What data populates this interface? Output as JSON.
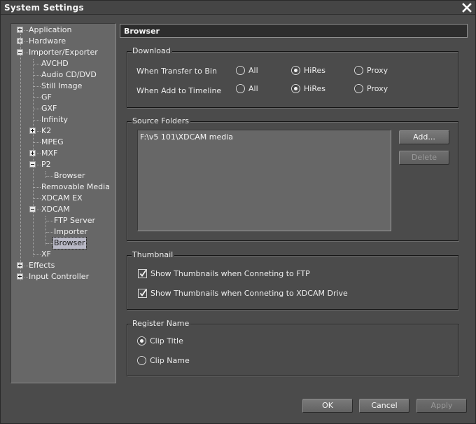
{
  "window": {
    "title": "System Settings",
    "close_icon": "close-icon"
  },
  "tree": {
    "items": [
      {
        "label": "Application",
        "level": 0,
        "toggle": "plus"
      },
      {
        "label": "Hardware",
        "level": 0,
        "toggle": "plus"
      },
      {
        "label": "Importer/Exporter",
        "level": 0,
        "toggle": "minus"
      },
      {
        "label": "AVCHD",
        "level": 1,
        "toggle": null
      },
      {
        "label": "Audio CD/DVD",
        "level": 1,
        "toggle": null
      },
      {
        "label": "Still Image",
        "level": 1,
        "toggle": null
      },
      {
        "label": "GF",
        "level": 1,
        "toggle": null
      },
      {
        "label": "GXF",
        "level": 1,
        "toggle": null
      },
      {
        "label": "Infinity",
        "level": 1,
        "toggle": null
      },
      {
        "label": "K2",
        "level": 1,
        "toggle": "plus"
      },
      {
        "label": "MPEG",
        "level": 1,
        "toggle": null
      },
      {
        "label": "MXF",
        "level": 1,
        "toggle": "plus"
      },
      {
        "label": "P2",
        "level": 1,
        "toggle": "minus"
      },
      {
        "label": "Browser",
        "level": 2,
        "toggle": null
      },
      {
        "label": "Removable Media",
        "level": 1,
        "toggle": null
      },
      {
        "label": "XDCAM EX",
        "level": 1,
        "toggle": null
      },
      {
        "label": "XDCAM",
        "level": 1,
        "toggle": "minus"
      },
      {
        "label": "FTP Server",
        "level": 2,
        "toggle": null
      },
      {
        "label": "Importer",
        "level": 2,
        "toggle": null
      },
      {
        "label": "Browser",
        "level": 2,
        "toggle": null,
        "selected": true
      },
      {
        "label": "XF",
        "level": 1,
        "toggle": null
      },
      {
        "label": "Effects",
        "level": 0,
        "toggle": "plus"
      },
      {
        "label": "Input Controller",
        "level": 0,
        "toggle": "plus"
      }
    ]
  },
  "panel": {
    "title": "Browser",
    "download": {
      "title": "Download",
      "rows": [
        {
          "label": "When Transfer to Bin",
          "options": [
            "All",
            "HiRes",
            "Proxy"
          ],
          "selected": "HiRes"
        },
        {
          "label": "When Add to Timeline",
          "options": [
            "All",
            "HiRes",
            "Proxy"
          ],
          "selected": "HiRes"
        }
      ]
    },
    "source_folders": {
      "title": "Source Folders",
      "items": [
        "F:\\v5 101\\XDCAM media"
      ],
      "add_label": "Add...",
      "delete_label": "Delete"
    },
    "thumbnail": {
      "title": "Thumbnail",
      "options": [
        {
          "label": "Show Thumbnails when Conneting to FTP",
          "checked": true
        },
        {
          "label": "Show Thumbnails when Conneting to XDCAM Drive",
          "checked": true
        }
      ]
    },
    "register_name": {
      "title": "Register Name",
      "options": [
        "Clip Title",
        "Clip Name"
      ],
      "selected": "Clip Title"
    }
  },
  "footer": {
    "ok_label": "OK",
    "cancel_label": "Cancel",
    "apply_label": "Apply"
  }
}
